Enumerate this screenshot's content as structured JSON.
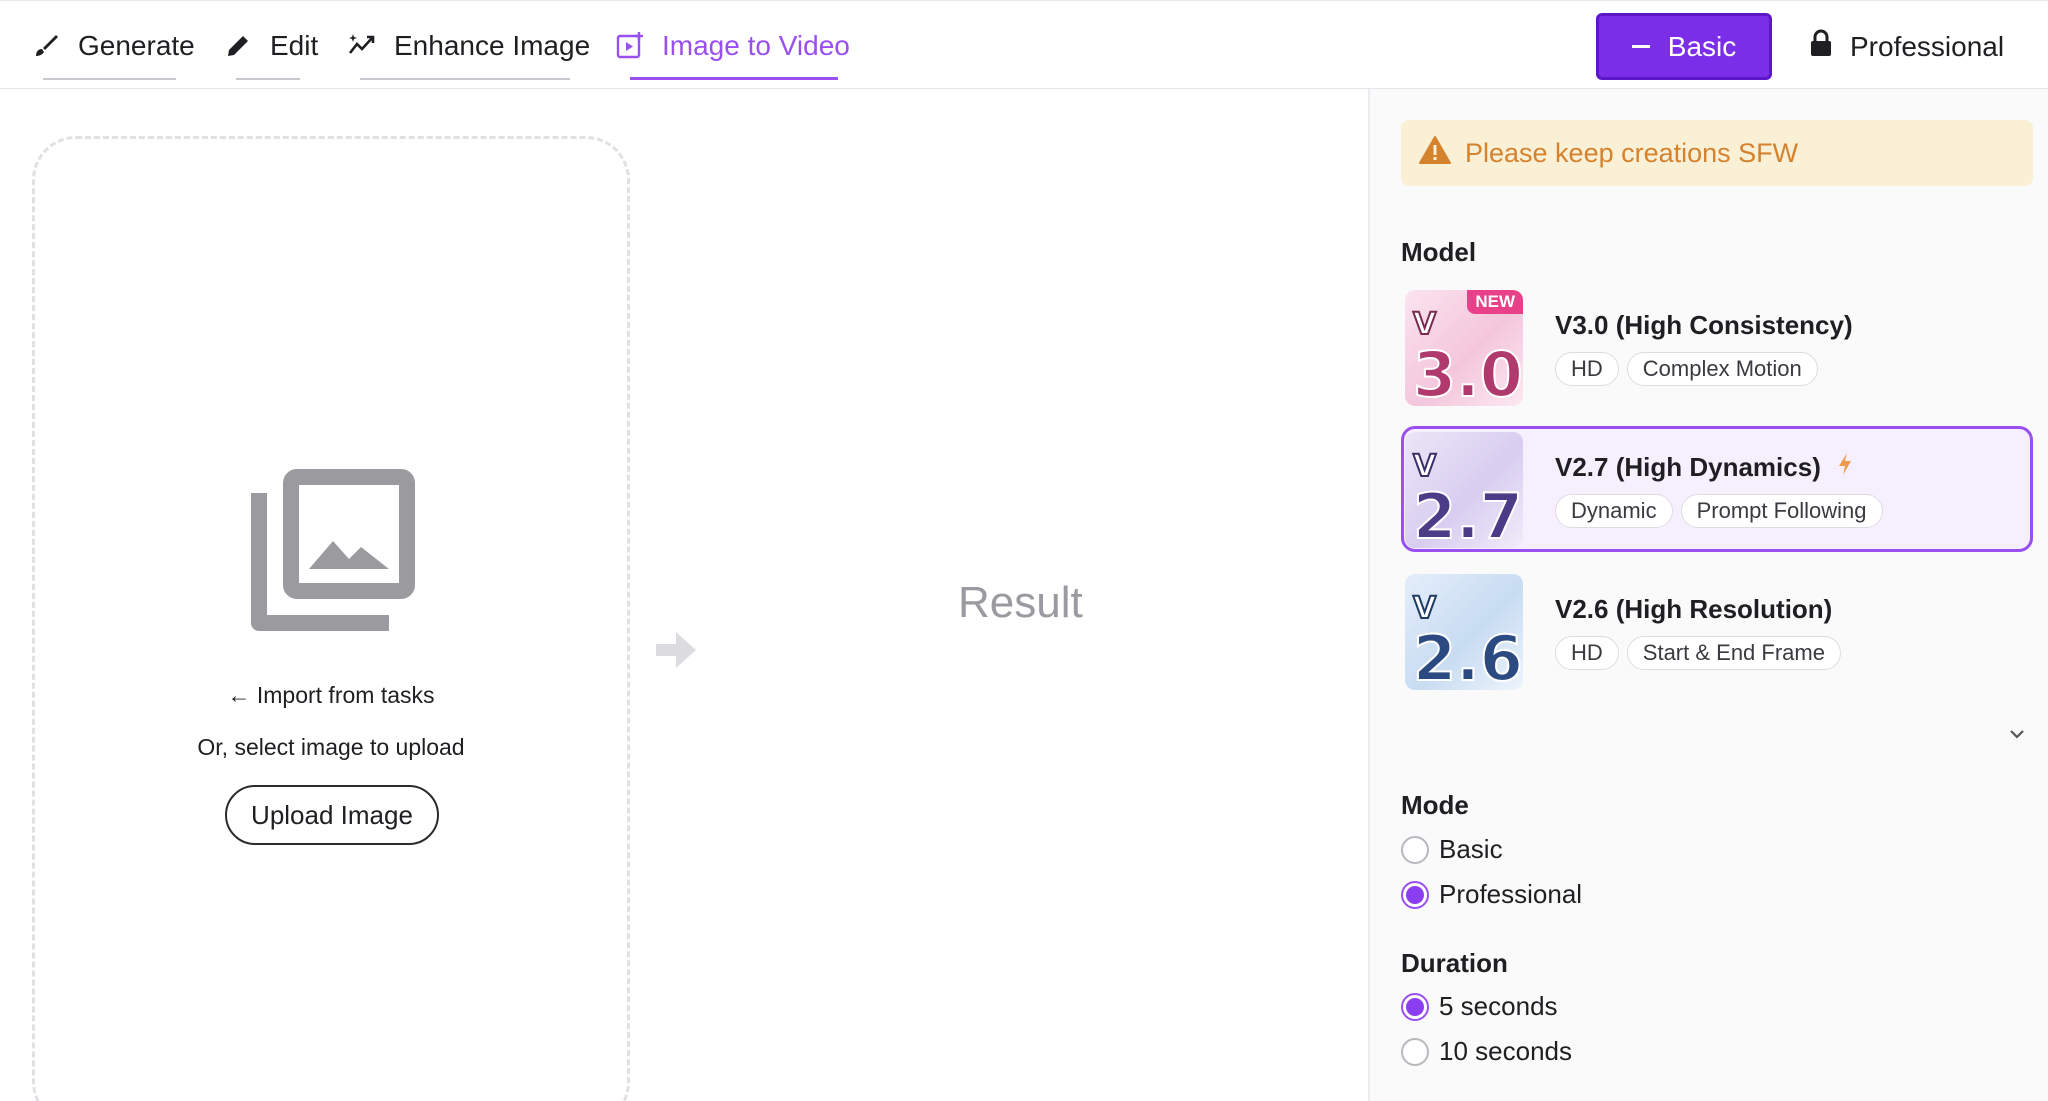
{
  "tabs": [
    {
      "label": "Generate",
      "icon": "brush-icon"
    },
    {
      "label": "Edit",
      "icon": "pencil-icon"
    },
    {
      "label": "Enhance Image",
      "icon": "enhance-icon"
    },
    {
      "label": "Image to Video",
      "icon": "video-add-icon",
      "active": true
    }
  ],
  "tier": {
    "basic_label": "Basic",
    "professional_label": "Professional"
  },
  "upload": {
    "import_label": "← Import from tasks",
    "or_select_label": "Or, select image to upload",
    "button_label": "Upload Image"
  },
  "result_label": "Result",
  "sidebar": {
    "warning": "Please keep creations SFW",
    "model_heading": "Model",
    "models": [
      {
        "name": "V3.0 (High Consistency)",
        "thumb_text": "3.0",
        "badge": "NEW",
        "tags": [
          "HD",
          "Complex Motion"
        ]
      },
      {
        "name": "V2.7 (High Dynamics)",
        "thumb_text": "2.7",
        "selected": true,
        "tags": [
          "Dynamic",
          "Prompt Following"
        ]
      },
      {
        "name": "V2.6 (High Resolution)",
        "thumb_text": "2.6",
        "tags": [
          "HD",
          "Start & End Frame"
        ]
      }
    ],
    "mode_heading": "Mode",
    "mode_options": [
      "Basic",
      "Professional"
    ],
    "mode_selected": "Professional",
    "duration_heading": "Duration",
    "duration_options": [
      "5 seconds",
      "10 seconds"
    ],
    "duration_selected": "5 seconds"
  },
  "colors": {
    "accent": "#9a4ff0",
    "basic_button": "#7a2ee8",
    "warning_bg": "#faf0d6",
    "warning_text": "#d4822e",
    "new_badge": "#e8418a"
  }
}
